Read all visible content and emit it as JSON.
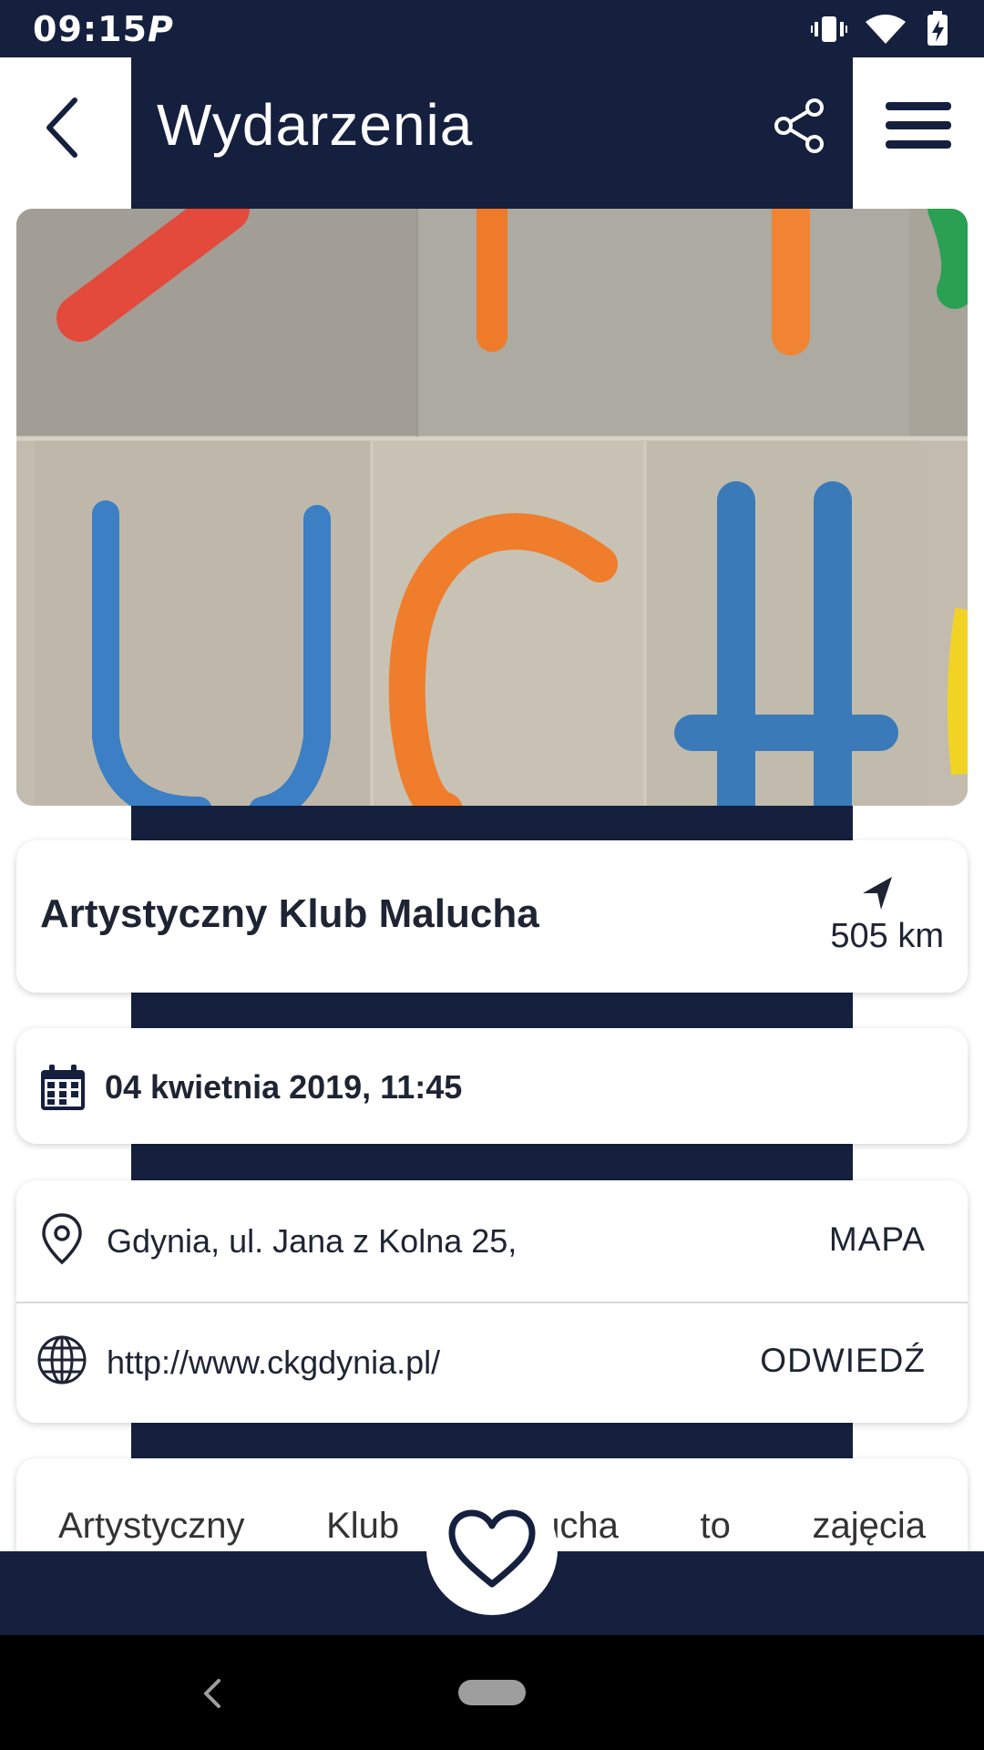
{
  "status_bar": {
    "time": "09:15",
    "app_indicator": "P",
    "icons": [
      "vibrate-icon",
      "wifi-icon",
      "battery-icon"
    ]
  },
  "header": {
    "title": "Wydarzenia",
    "back_icon": "chevron-left-icon",
    "share_icon": "share-icon",
    "menu_icon": "hamburger-menu-icon"
  },
  "event": {
    "name": "Artystyczny Klub Malucha",
    "distance": "505 km",
    "date": "04 kwietnia 2019, 11:45",
    "address": "Gdynia, ul. Jana z Kolna 25,",
    "map_label": "MAPA",
    "website": "http://www.ckgdynia.pl/",
    "visit_label": "ODWIEDŹ",
    "description": "Artystyczny Klub Malucha to zajęcia"
  },
  "colors": {
    "navy": "#15203f",
    "text": "#1e2433",
    "white": "#ffffff"
  }
}
